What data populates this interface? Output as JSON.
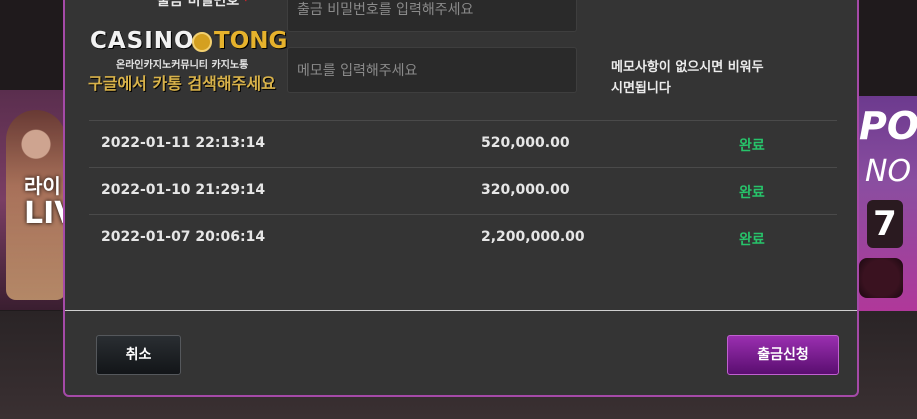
{
  "background": {
    "left_banner_text": "라이",
    "left_banner_big": "LIV",
    "right_banner_text": "PO",
    "right_banner_sub": "NO",
    "right_banner_digit": "7"
  },
  "form": {
    "password_label": "출금 비밀번호",
    "required_mark": "*",
    "password_placeholder": "출금 비밀번호를 입력해주세요",
    "memo_placeholder": "메모를 입력해주세요",
    "memo_note_line1": "메모사항이 없으시면 비워두",
    "memo_note_line2": "시면됩니다"
  },
  "history": [
    {
      "date": "2022-01-11 22:13:14",
      "amount": "520,000.00",
      "status": "완료"
    },
    {
      "date": "2022-01-10 21:29:14",
      "amount": "320,000.00",
      "status": "완료"
    },
    {
      "date": "2022-01-07 20:06:14",
      "amount": "2,200,000.00",
      "status": "완료"
    }
  ],
  "buttons": {
    "cancel": "취소",
    "submit": "출금신청"
  },
  "watermark": {
    "brand_left": "CASINO",
    "brand_right": "TONG",
    "tagline": "온라인카지노커뮤니티 카지노통",
    "search_hint": "구글에서 카통 검색해주세요"
  },
  "colors": {
    "modal_bg": "#343434",
    "modal_border": "#a54aa8",
    "status_complete": "#27c36a",
    "submit_button": "#7a1e92",
    "required": "#e0202a"
  }
}
